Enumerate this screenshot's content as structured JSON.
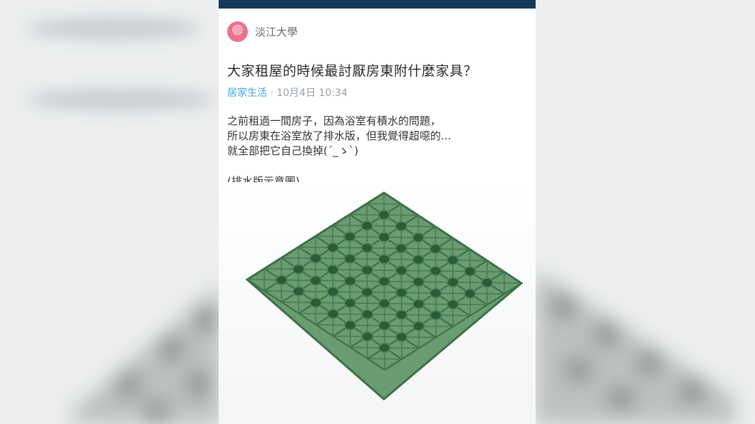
{
  "post": {
    "school": "淡江大學",
    "title": "大家租屋的時候最討厭房東附什麼家具？",
    "category": "居家生活",
    "separator": "·",
    "datetime": "10月4日 10:34",
    "body_lines": [
      "之前租過一間房子，因為浴室有積水的問題，",
      "所以房東在浴室放了排水版，但我覺得超噁的...",
      "就全部把它自己換掉(´_ゝ`)"
    ],
    "image_caption": "(排水版示意圖)"
  },
  "colors": {
    "topbar": "#14395a",
    "category": "#3da8d8",
    "mat_green": "#4e8a5c"
  },
  "icons": {
    "avatar": "avatar-icon"
  }
}
